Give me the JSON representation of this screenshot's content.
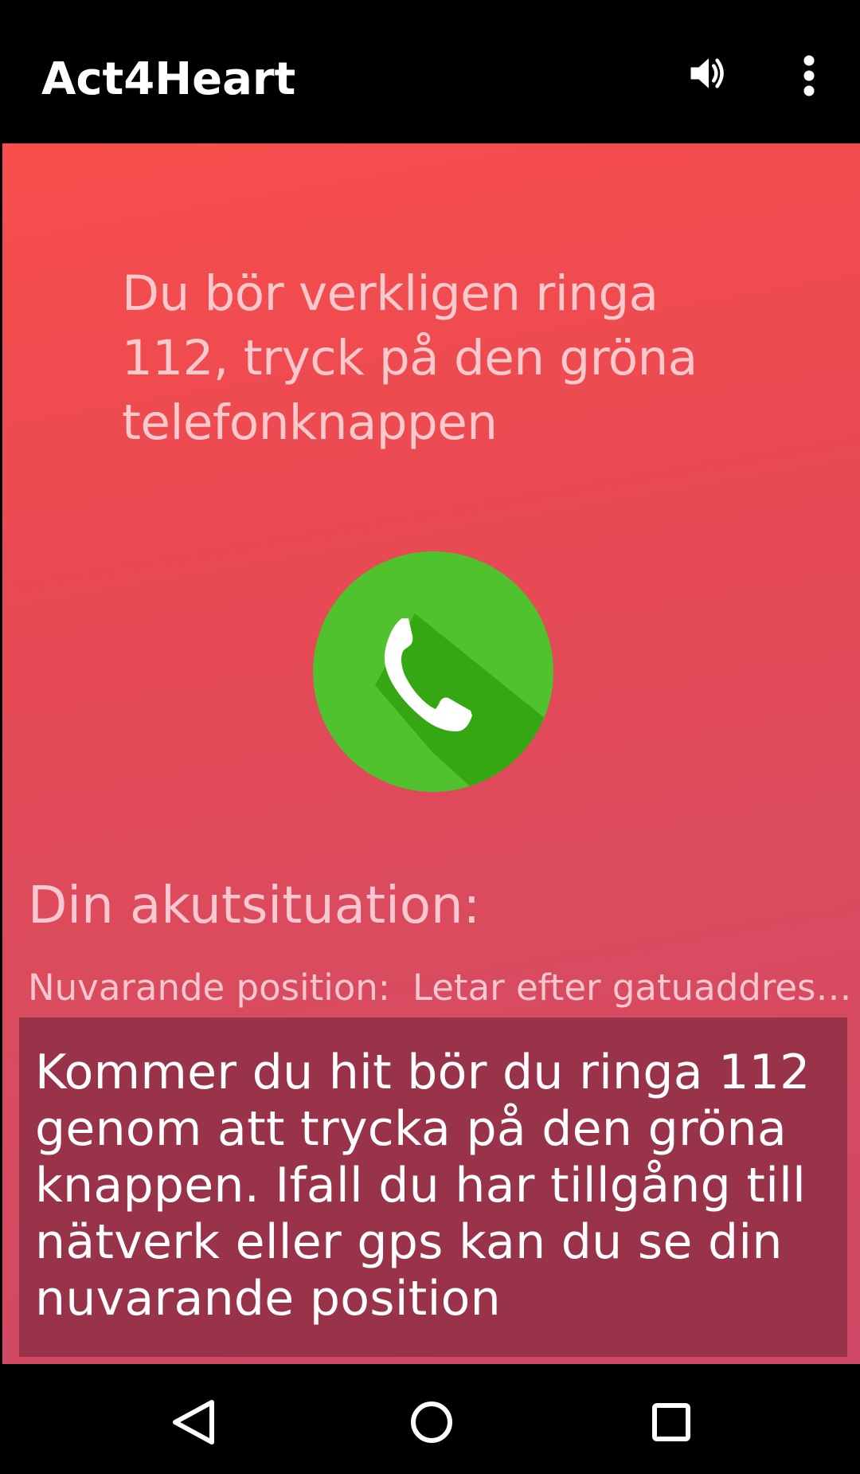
{
  "app_bar": {
    "title": "Act4Heart",
    "actions": [
      {
        "name": "volume",
        "icon": "volume-icon"
      },
      {
        "name": "overflow-menu",
        "icon": "more-vert-icon"
      }
    ]
  },
  "main": {
    "instruction": "Du bör verkligen ringa 112, tryck på den gröna telefonknappen",
    "call_button": {
      "icon": "phone-icon",
      "color": "#50c22e",
      "shadow_color": "#34a713"
    },
    "section_title": "Din akutsituation:",
    "position": {
      "label": "Nuvarande position:",
      "value": "Letar efter gatuaddress..."
    },
    "info_text": "Kommer du hit bör du ringa 112 genom att trycka på den gröna knappen. Ifall du har tillgång till nätverk eller gps kan du se din nuvarande position"
  },
  "nav_bar": {
    "buttons": [
      {
        "name": "back",
        "icon": "back-triangle-icon"
      },
      {
        "name": "home",
        "icon": "home-circle-icon"
      },
      {
        "name": "recents",
        "icon": "recents-square-icon"
      }
    ]
  },
  "colors": {
    "background_top": "#f84d4c",
    "background_bottom": "#cf4865",
    "info_panel": "#99334a",
    "bars": "#000000"
  }
}
